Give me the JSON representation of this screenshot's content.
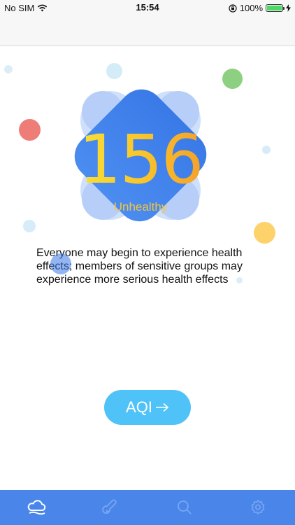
{
  "status": {
    "carrier": "No SIM",
    "time": "15:54",
    "battery": "100%",
    "battery_level": 1.0,
    "icons": [
      "wifi-icon",
      "orientation-lock-icon",
      "battery-icon",
      "charging-icon"
    ]
  },
  "aqi": {
    "value": "156",
    "level": "Unhealthy",
    "description": "Everyone may begin to experience health effects; members of sensitive groups may experience more serious health effects"
  },
  "actions": {
    "aqi_button_label": "AQI",
    "aqi_button_icon": "arrow-right-icon"
  },
  "tabs": [
    {
      "icon": "cloud-icon",
      "active": true
    },
    {
      "icon": "thermometer-icon",
      "active": false
    },
    {
      "icon": "search-icon",
      "active": false
    },
    {
      "icon": "gear-icon",
      "active": false
    }
  ],
  "colors": {
    "badge": "#3f7ee8",
    "tab_bar": "#4a86ea",
    "button": "#4fc3f7",
    "value_gradient": [
      "#f7e43a",
      "#f59a28"
    ],
    "level": "#f5c63a"
  }
}
